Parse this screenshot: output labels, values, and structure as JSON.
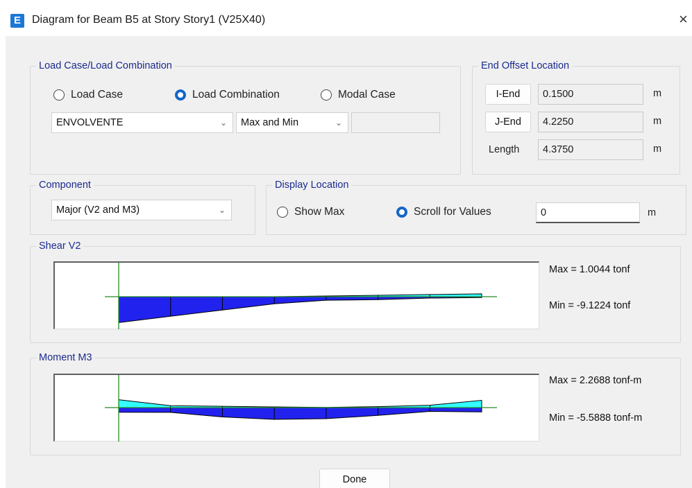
{
  "window": {
    "icon_letter": "E",
    "title": "Diagram for Beam B5 at Story Story1 (V25X40)",
    "close_glyph": "×"
  },
  "load_case": {
    "group_label": "Load Case/Load Combination",
    "radios": [
      {
        "label": "Load Case",
        "selected": false
      },
      {
        "label": "Load Combination",
        "selected": true
      },
      {
        "label": "Modal Case",
        "selected": false
      }
    ],
    "combo_value": "ENVOLVENTE",
    "type_value": "Max and Min"
  },
  "end_offset": {
    "group_label": "End Offset Location",
    "i_end_button": "I-End",
    "i_end_value": "0.1500",
    "j_end_button": "J-End",
    "j_end_value": "4.2250",
    "length_label": "Length",
    "length_value": "4.3750",
    "unit": "m"
  },
  "component": {
    "group_label": "Component",
    "value": "Major (V2 and M3)"
  },
  "display_location": {
    "group_label": "Display Location",
    "radios": [
      {
        "label": "Show Max",
        "selected": false
      },
      {
        "label": "Scroll for Values",
        "selected": true
      }
    ],
    "location_value": "0",
    "unit": "m"
  },
  "shear": {
    "group_label": "Shear V2",
    "max_text": "Max = 1.0044 tonf",
    "min_text": "Min = -9.1224 tonf",
    "stations": [
      0.0,
      0.625,
      1.25,
      1.875,
      2.5,
      3.125,
      3.75,
      4.375
    ],
    "max_values": [
      0.0,
      0.0,
      0.0,
      0.0,
      0.248,
      0.496,
      0.75,
      1.0044
    ],
    "min_values": [
      -9.1224,
      -6.9,
      -4.7,
      -2.5,
      -1.25,
      -1.05,
      -0.5,
      -0.3
    ]
  },
  "moment": {
    "group_label": "Moment M3",
    "max_text": "Max = 2.2688 tonf-m",
    "min_text": "Min = -5.5888 tonf-m",
    "stations": [
      0.0,
      0.625,
      1.25,
      1.875,
      2.5,
      3.125,
      3.75,
      4.375
    ],
    "max_values": [
      2.2688,
      0.55,
      0.38,
      0.2,
      0.05,
      0.28,
      0.68,
      2.1
    ],
    "min_values": [
      -1.35,
      -1.38,
      -2.7,
      -3.4,
      -3.2,
      -2.25,
      -1.1,
      -1.25
    ]
  },
  "colors": {
    "positive_fill": "#33ffff",
    "negative_fill": "#2222ee",
    "axis": "#228b22",
    "accent": "#1b2a8f"
  },
  "buttons": {
    "done": "Done"
  }
}
